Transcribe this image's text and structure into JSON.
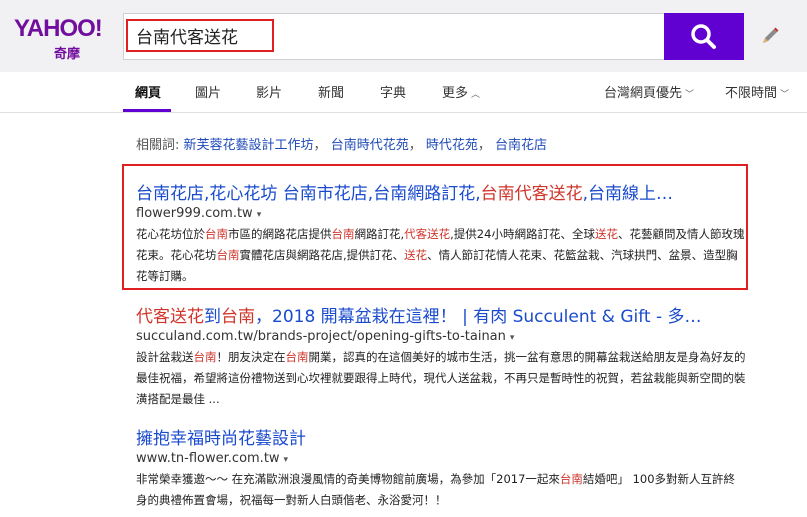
{
  "logo": {
    "brand": "YAHOO!",
    "sub": "奇摩"
  },
  "search": {
    "query": "台南代客送花"
  },
  "tabs": [
    {
      "label": "網頁"
    },
    {
      "label": "圖片"
    },
    {
      "label": "影片"
    },
    {
      "label": "新聞"
    },
    {
      "label": "字典"
    },
    {
      "label": "更多"
    }
  ],
  "filters": {
    "region": "台灣網頁優先",
    "time": "不限時間"
  },
  "related": {
    "label": "相關詞:",
    "links": [
      "新芙蓉花藝設計工作坊",
      "台南時代花苑",
      "時代花苑",
      "台南花店"
    ]
  },
  "results": [
    {
      "title_parts": [
        {
          "text": "台南花店,花心花坊 台南市花店,台南網路訂花,",
          "hl": false
        },
        {
          "text": "台南代客送花",
          "hl": true
        },
        {
          "text": ",台南線上…",
          "hl": false
        }
      ],
      "url": "flower999.com.tw",
      "snippet_parts": [
        {
          "text": "花心花坊位於",
          "hl": false
        },
        {
          "text": "台南",
          "hl": true
        },
        {
          "text": "市區的網路花店提供",
          "hl": false
        },
        {
          "text": "台南",
          "hl": true
        },
        {
          "text": "網路訂花,",
          "hl": false
        },
        {
          "text": "代客送花",
          "hl": true
        },
        {
          "text": ",提供24小時網路訂花、全球",
          "hl": false
        },
        {
          "text": "送花",
          "hl": true
        },
        {
          "text": "、花藝顧問及情人節玫瑰花束。花心花坊",
          "hl": false
        },
        {
          "text": "台南",
          "hl": true
        },
        {
          "text": "實體花店與網路花店,提供訂花、",
          "hl": false
        },
        {
          "text": "送花",
          "hl": true
        },
        {
          "text": "、情人節訂花情人花束、花籃盆栽、汽球拱門、盆景、造型胸花等訂購。",
          "hl": false
        }
      ]
    },
    {
      "title_parts": [
        {
          "text": "代客送花",
          "hl": true
        },
        {
          "text": "到",
          "hl": false
        },
        {
          "text": "台南",
          "hl": true
        },
        {
          "text": "，2018 開幕盆栽在這裡！ | 有肉 Succulent & Gift - 多…",
          "hl": false
        }
      ],
      "url": "succuland.com.tw/brands-project/opening-gifts-to-tainan",
      "snippet_parts": [
        {
          "text": "設計盆栽送",
          "hl": false
        },
        {
          "text": "台南",
          "hl": true
        },
        {
          "text": "！朋友決定在",
          "hl": false
        },
        {
          "text": "台南",
          "hl": true
        },
        {
          "text": "開業，認真的在這個美好的城市生活，挑一盆有意思的開幕盆栽送給朋友是身為好友的最佳祝福，希望將這份禮物送到心坎裡就要跟得上時代，現代人送盆栽，不再只是暫時性的祝賀，若盆栽能與新空間的裝潢搭配是最佳 ...",
          "hl": false
        }
      ]
    },
    {
      "title_parts": [
        {
          "text": "擁抱幸福時尚花藝設計",
          "hl": false
        }
      ],
      "url": "www.tn-flower.com.tw",
      "snippet_parts": [
        {
          "text": "非常榮幸獲邀～～ 在充滿歐洲浪漫風情的奇美博物館前廣場，為參加「2017一起來",
          "hl": false
        },
        {
          "text": "台南",
          "hl": true
        },
        {
          "text": "結婚吧」 100多對新人互許終身的典禮佈置會場，祝福每一對新人白頭偕老、永浴愛河！！",
          "hl": false
        }
      ]
    }
  ],
  "colors": {
    "brand": "#720e9e",
    "search_button": "#6001d2",
    "link": "#1a4bcd",
    "highlight": "#d0352b",
    "annotation": "#e02020"
  }
}
